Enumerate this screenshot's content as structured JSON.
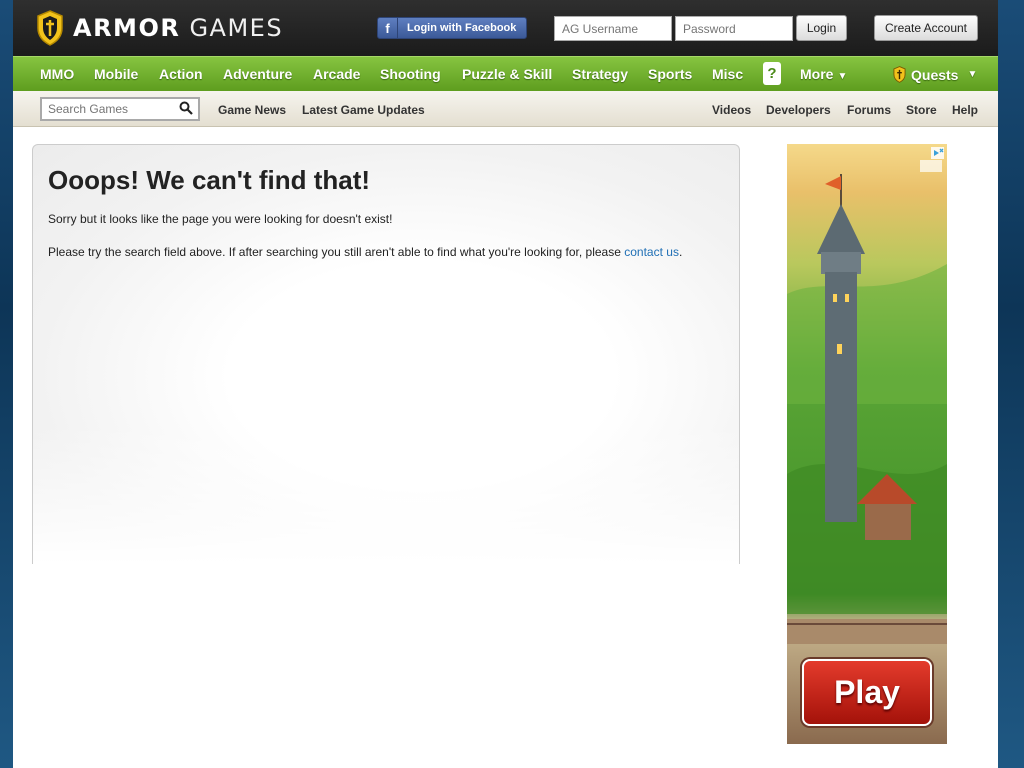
{
  "header": {
    "logo_bold": "ARMOR",
    "logo_rest": " GAMES",
    "facebook_label": "Login with Facebook",
    "username_placeholder": "AG Username",
    "password_placeholder": "Password",
    "login_label": "Login",
    "create_account_label": "Create Account"
  },
  "nav": {
    "items": [
      "MMO",
      "Mobile",
      "Action",
      "Adventure",
      "Arcade",
      "Shooting",
      "Puzzle & Skill",
      "Strategy",
      "Sports",
      "Misc"
    ],
    "help_glyph": "?",
    "more_label": "More",
    "quests_label": "Quests"
  },
  "subnav": {
    "search_placeholder": "Search Games",
    "left_links": [
      "Game News",
      "Latest Game Updates"
    ],
    "right_links": [
      "Videos",
      "Developers",
      "Forums",
      "Store",
      "Help"
    ]
  },
  "content": {
    "title": "Ooops! We can't find that!",
    "paragraph1": "Sorry but it looks like the page you were looking for doesn't exist!",
    "paragraph2_before": "Please try the search field above. If after searching you still aren't able to find what you're looking for, please ",
    "contact_link": "contact us",
    "paragraph2_after": "."
  },
  "ad": {
    "play_label": "Play"
  },
  "colors": {
    "nav_green": "#6fae2c",
    "link_blue": "#1f6fb5",
    "facebook_blue": "#3b5998",
    "play_red": "#c0201a"
  }
}
